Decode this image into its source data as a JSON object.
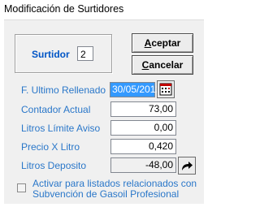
{
  "window": {
    "title": "Modificación de Surtidores"
  },
  "surtidor": {
    "label": "Surtidor",
    "value": "2"
  },
  "buttons": {
    "accept": "Aceptar",
    "accept_mnemonic": "A",
    "accept_rest": "ceptar",
    "cancel": "Cancelar",
    "cancel_mnemonic": "C",
    "cancel_rest": "ancelar"
  },
  "fields": [
    {
      "label": "F. Ultimo Rellenado",
      "value": "30/05/2012"
    },
    {
      "label": "Contador Actual",
      "value": "73,00"
    },
    {
      "label": "Litros Límite Aviso",
      "value": "0,00"
    },
    {
      "label": "Precio X Litro",
      "value": "0,420"
    },
    {
      "label": "Litros Deposito",
      "value": "-48,00"
    }
  ],
  "checkbox": {
    "line1": "Activar para listados relacionados con",
    "line2": "Subvención de Gasoil Profesional",
    "checked": false
  },
  "icons": {
    "calendar": "calendar-icon",
    "arrow": "curved-arrow-icon"
  }
}
